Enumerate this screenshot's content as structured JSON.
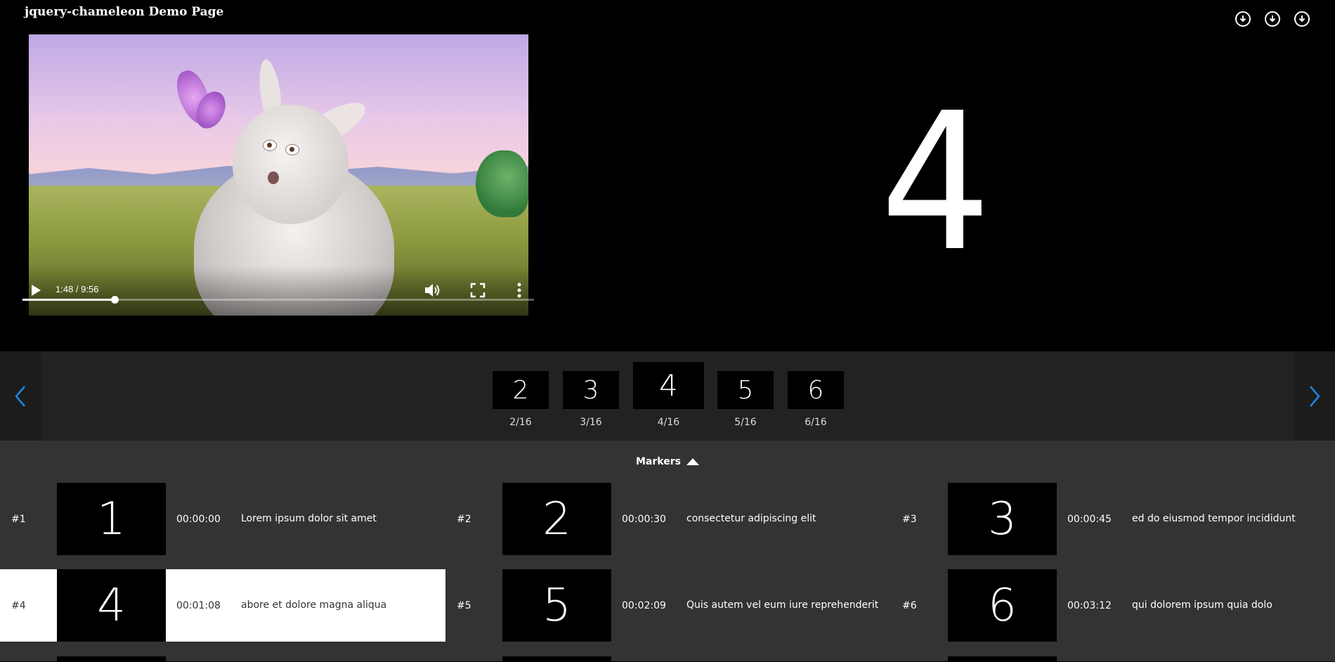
{
  "page": {
    "title": "jquery-chameleon Demo Page"
  },
  "downloads": [
    {
      "icon": "download-icon"
    },
    {
      "icon": "download-icon"
    },
    {
      "icon": "download-icon"
    }
  ],
  "player": {
    "time_display": "1:48 / 9:56",
    "progress_fraction": 0.18,
    "icons": [
      "play-icon",
      "volume-icon",
      "fullscreen-icon",
      "more-options-icon"
    ]
  },
  "current_slide": {
    "number": "4"
  },
  "carousel": {
    "prev_icon": "chevron-left-icon",
    "next_icon": "chevron-right-icon",
    "items": [
      {
        "num": "2",
        "label": "2/16",
        "active": false
      },
      {
        "num": "3",
        "label": "3/16",
        "active": false
      },
      {
        "num": "4",
        "label": "4/16",
        "active": true
      },
      {
        "num": "5",
        "label": "5/16",
        "active": false
      },
      {
        "num": "6",
        "label": "6/16",
        "active": false
      }
    ]
  },
  "markers": {
    "toggle_label": "Markers",
    "toggle_icon": "caret-up-icon",
    "items": [
      {
        "idx": "#1",
        "num": "1",
        "time": "00:00:00",
        "text": "Lorem ipsum dolor sit amet",
        "active": false
      },
      {
        "idx": "#2",
        "num": "2",
        "time": "00:00:30",
        "text": "consectetur adipiscing elit",
        "active": false
      },
      {
        "idx": "#3",
        "num": "3",
        "time": "00:00:45",
        "text": "ed do eiusmod tempor incididunt",
        "active": false
      },
      {
        "idx": "#4",
        "num": "4",
        "time": "00:01:08",
        "text": "abore et dolore magna aliqua",
        "active": true
      },
      {
        "idx": "#5",
        "num": "5",
        "time": "00:02:09",
        "text": "Quis autem vel eum iure reprehenderit",
        "active": false
      },
      {
        "idx": "#6",
        "num": "6",
        "time": "00:03:12",
        "text": "qui dolorem ipsum quia dolo",
        "active": false
      }
    ]
  },
  "colors": {
    "accent": "#1e88e5",
    "stage_bg": "#000000",
    "strip_bg": "#222222",
    "markers_bg": "#333333",
    "active_marker_bg": "#ffffff"
  }
}
